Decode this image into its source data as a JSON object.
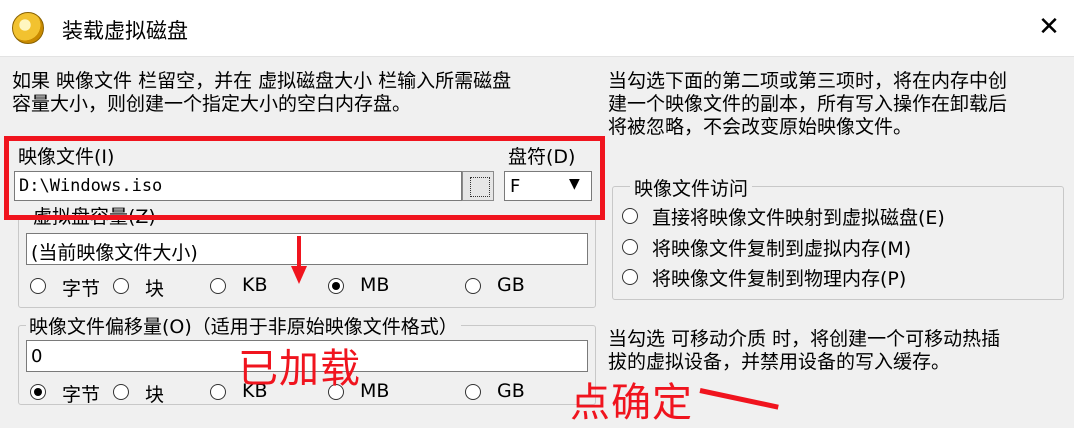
{
  "window": {
    "title": "装载虚拟磁盘"
  },
  "info": {
    "left_line1": "如果 映像文件 栏留空，并在 虚拟磁盘大小 栏输入所需磁盘",
    "left_line2": "容量大小，则创建一个指定大小的空白内存盘。",
    "right_line1": "当勾选下面的第二项或第三项时，将在内存中创",
    "right_line2": "建一个映像文件的副本，所有写入操作在卸载后",
    "right_line3": "将被忽略，不会改变原始映像文件。"
  },
  "image_file": {
    "label": "映像文件(I)",
    "value": "D:\\Windows.iso"
  },
  "drive": {
    "label": "盘符(D)",
    "value": "F"
  },
  "disk_size": {
    "label": "虚拟盘容量(Z)",
    "value": "(当前映像文件大小)",
    "units": [
      "字节",
      "块",
      "KB",
      "MB",
      "GB"
    ],
    "selected": "MB"
  },
  "access": {
    "label": "映像文件访问",
    "options": [
      "直接将映像文件映射到虚拟磁盘(E)",
      "将映像文件复制到虚拟内存(M)",
      "将映像文件复制到物理内存(P)"
    ],
    "selected": null
  },
  "offset": {
    "label": "映像文件偏移量(O)（适用于非原始映像文件格式）",
    "value": "0",
    "units": [
      "字节",
      "块",
      "KB",
      "MB",
      "GB"
    ],
    "selected": "字节"
  },
  "removable_info": {
    "line1": "当勾选 可移动介质 时，将创建一个可移动热插",
    "line2": "拔的虚拟设备，并禁用设备的写入缓存。"
  },
  "annotations": {
    "loaded": "已加载",
    "confirm": "点确定"
  },
  "colors": {
    "annotation": "#f0141e",
    "title_bg": "#ffffff",
    "dialog_bg": "#f0f0f0"
  }
}
